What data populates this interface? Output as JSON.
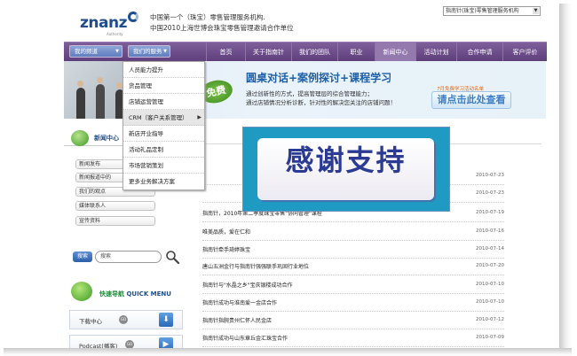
{
  "header": {
    "logo_text": "znanz",
    "logo_sub": "Authority",
    "tagline1": "中国第一个（珠宝）零售管理服务机构.",
    "tagline2": "中国2010上海世博会珠宝零售管理邀请合作单位",
    "site_select": "指南针(珠宝)零售管理服务机构"
  },
  "nav": {
    "all_categories": "我的频道",
    "our_services": "我们的服务",
    "items": [
      "首页",
      "关于指南针",
      "我们的团队",
      "职业",
      "新闻中心",
      "活动计划",
      "合作申请",
      "客户评价"
    ],
    "active": "新闻中心"
  },
  "dropdown": {
    "items": [
      "人员能力提升",
      "货品管理",
      "店铺运营管理",
      "CRM（客户关系管理）",
      "新店开业指导",
      "活动礼品定制",
      "市场营销策划",
      "更多业务解决方案"
    ],
    "highlighted": "CRM（客户关系管理）"
  },
  "banner": {
    "badge": "免费",
    "title": "圆桌对话+案例探讨+课程学习",
    "line1": "通过创新性的方式，提高管理层的综合管理能力；",
    "line2": "通过店铺情况分析诊断，针对性的解决您关注的店铺问题！",
    "promo": "7月免费学习活动名单",
    "cta": "请点击此处查看"
  },
  "news_categories": {
    "title": "新闻中心",
    "items": [
      "新闻发布",
      "新闻报道中的",
      "我们的观点",
      "媒体联系人",
      "宣传资料"
    ]
  },
  "search": {
    "label": "搜索",
    "placeholder": "搜索"
  },
  "quick_nav": {
    "title": "快速导航",
    "title_en": "QUICK MENU",
    "rows": [
      {
        "label": "下载中心",
        "go": "GO"
      },
      {
        "label": "Podcast(播客)",
        "go": "GO"
      }
    ]
  },
  "news": [
    {
      "title": "",
      "date": "2010-07-23"
    },
    {
      "title": "",
      "date": "2010-07-23"
    },
    {
      "title": "指南针，2010年第二季度珠宝零售\"协同管理\"课程",
      "date": "2010-07-19"
    },
    {
      "title": "唯美品质，爱在仁和",
      "date": "2010-07-16"
    },
    {
      "title": "指南针牵手琦婷珠宝",
      "date": "2010-07-14"
    },
    {
      "title": "唐山五洲金行与指南针强强联手巩固行业地位",
      "date": "2010-07-20"
    },
    {
      "title": "指南针与\"水晶之乡\"宝庆银楼成功合作",
      "date": "2010-07-10"
    },
    {
      "title": "指南针成功与淮南爱一金店合作",
      "date": "2010-07-10"
    },
    {
      "title": "指南针指腕贵州仁怀人民金店",
      "date": "2010-07-12"
    },
    {
      "title": "指南针成功与山东章丘金汇珠宝合作",
      "date": "2010-07-09"
    }
  ],
  "overlay": {
    "text": "感谢支持"
  }
}
